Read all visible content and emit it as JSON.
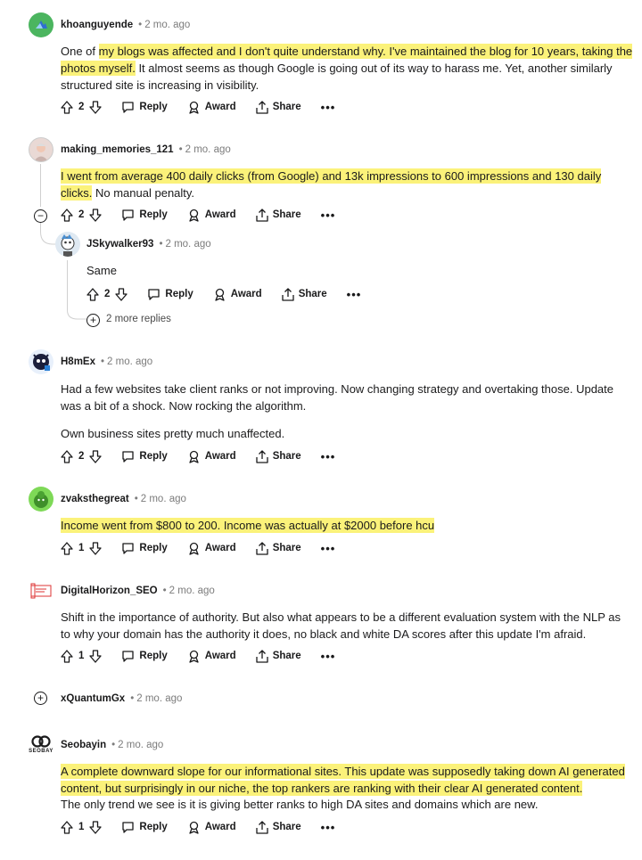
{
  "comments": [
    {
      "user": "khoanguyende",
      "time": "2 mo. ago",
      "votes": "2",
      "body": [
        {
          "t": "One of ",
          "h": false
        },
        {
          "t": "my blogs was affected and I don't quite understand why. I've maintained the blog for 10 years, taking the photos myself.",
          "h": true
        },
        {
          "t": " It almost seems as though Google is going out of its way to harass me. Yet, another similarly structured site is increasing in visibility.",
          "h": false
        }
      ]
    },
    {
      "user": "making_memories_121",
      "time": "2 mo. ago",
      "votes": "2",
      "body": [
        {
          "t": "I went from average 400 daily clicks (from Google) and 13k impressions to 600 impressions and 130 daily clicks.",
          "h": true
        },
        {
          "t": " No manual penalty.",
          "h": false
        }
      ]
    },
    {
      "user": "JSkywalker93",
      "time": "2 mo. ago",
      "votes": "2",
      "body": [
        {
          "t": "Same",
          "h": false
        }
      ]
    },
    {
      "user": "H8mEx",
      "time": "2 mo. ago",
      "votes": "2",
      "body_p1": "Had a few websites take client ranks or not improving. Now changing strategy and overtaking those. Update was a bit of a shock. Now rocking the algorithm.",
      "body_p2": "Own business sites pretty much unaffected."
    },
    {
      "user": "zvaksthegreat",
      "time": "2 mo. ago",
      "votes": "1",
      "body": [
        {
          "t": "Income went from $800 to 200. Income was actually at $2000 before hcu",
          "h": true
        }
      ]
    },
    {
      "user": "DigitalHorizon_SEO",
      "time": "2 mo. ago",
      "votes": "1",
      "body": [
        {
          "t": "Shift in the importance of authority. But also what appears to be a different evaluation system with the NLP as to why your domain has the authority it does, no black and white DA scores after this update I'm afraid.",
          "h": false
        }
      ]
    },
    {
      "user": "xQuantumGx",
      "time": "2 mo. ago"
    },
    {
      "user": "Seobayin",
      "time": "2 mo. ago",
      "votes": "1",
      "body": [
        {
          "t": "A complete downward slope for our informational sites. This update was supposedly taking down AI generated content, but surprisingly in our niche, the top rankers are ranking with their clear AI generated content.",
          "h": true
        }
      ],
      "body_p2": "The only trend we see is it is giving better ranks to high DA sites and domains which are new."
    }
  ],
  "labels": {
    "reply": "Reply",
    "award": "Award",
    "share": "Share",
    "more": "•••",
    "more_replies": "2 more replies",
    "seobay_logo_text": "SEOBAY"
  },
  "colors": {
    "highlight": "#fbf27a",
    "meta": "#7c7c7c",
    "text": "#1a1a1b"
  },
  "icons": [
    "upvote-icon",
    "downvote-icon",
    "reply-icon",
    "award-icon",
    "share-icon",
    "collapse-icon",
    "expand-icon"
  ]
}
